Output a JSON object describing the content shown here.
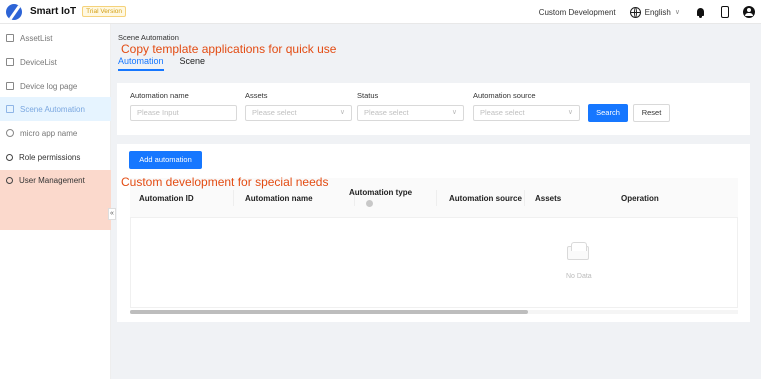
{
  "header": {
    "app_name": "Smart IoT",
    "trial_badge": "Trial Version",
    "custom_dev": "Custom Development",
    "language": "English"
  },
  "sidebar": {
    "items": [
      {
        "label": "AssetList"
      },
      {
        "label": "DeviceList"
      },
      {
        "label": "Device log page"
      },
      {
        "label": "Scene Automation"
      },
      {
        "label": "micro app name"
      },
      {
        "label": "Role permissions"
      },
      {
        "label": "User Management"
      }
    ],
    "collapse_glyph": "«"
  },
  "main": {
    "breadcrumb": "Scene Automation",
    "annotation_top": "Copy template applications for quick use",
    "annotation_mid": "Custom development for special needs",
    "tabs": [
      {
        "label": "Automation",
        "active": true
      },
      {
        "label": "Scene",
        "active": false
      }
    ]
  },
  "filters": {
    "name_label": "Automation name",
    "name_placeholder": "Please Input",
    "assets_label": "Assets",
    "assets_placeholder": "Please select",
    "status_label": "Status",
    "status_placeholder": "Please select",
    "source_label": "Automation source",
    "source_placeholder": "Please select",
    "search_btn": "Search",
    "reset_btn": "Reset"
  },
  "table": {
    "add_btn": "Add automation",
    "columns": [
      "Automation ID",
      "Automation name",
      "Automation type",
      "Automation source",
      "Assets",
      "Operation"
    ],
    "empty_text": "No Data"
  }
}
